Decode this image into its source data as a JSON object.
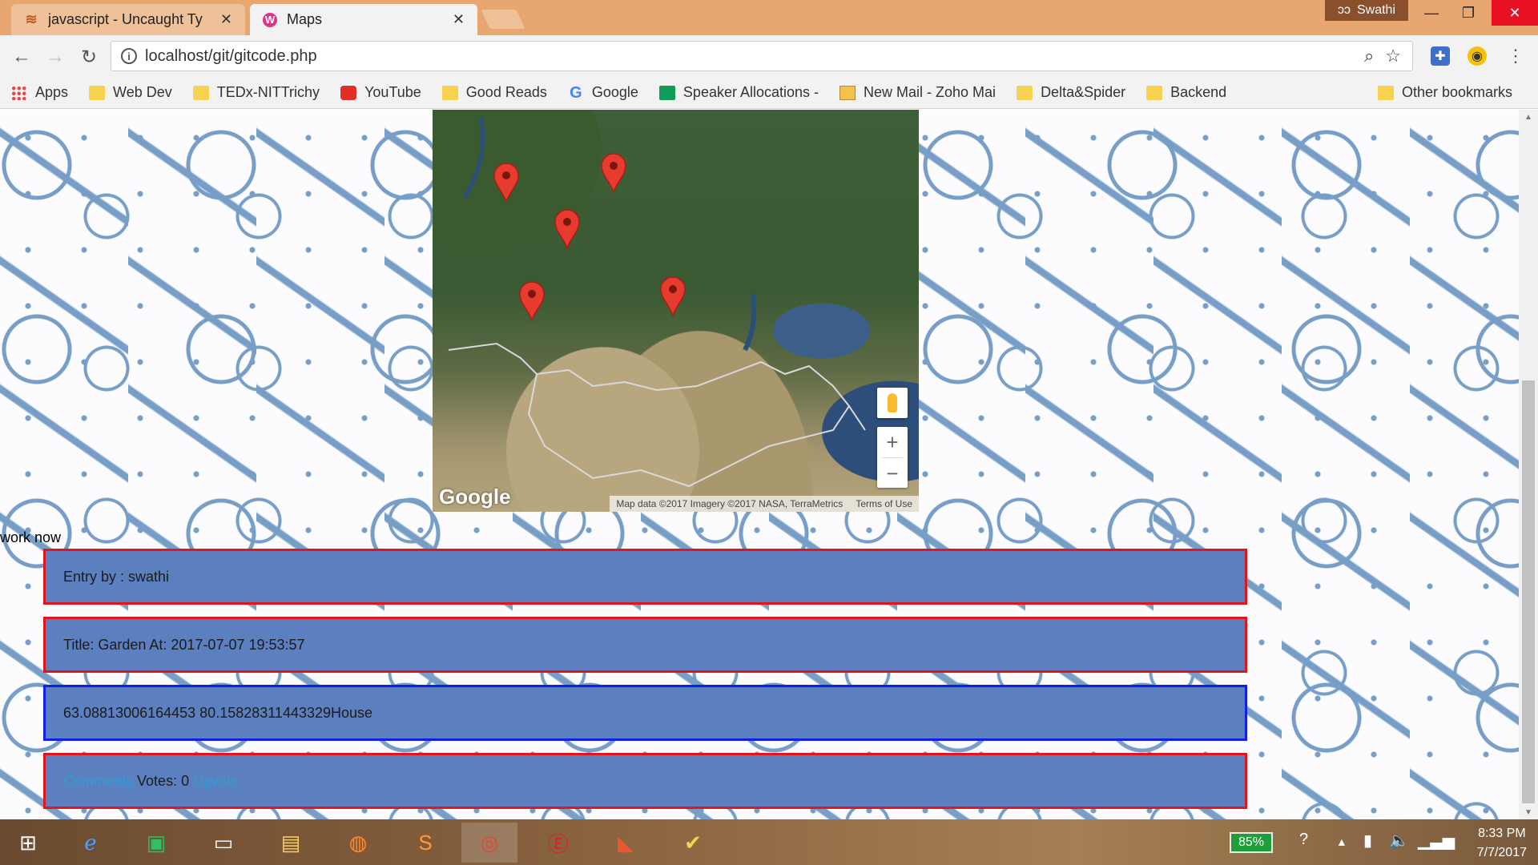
{
  "browser": {
    "tabs": [
      {
        "title": "javascript - Uncaught Ty",
        "close": "✕",
        "active": false
      },
      {
        "title": "Maps",
        "close": "✕",
        "active": true
      }
    ],
    "profile_name": "Swathi",
    "window_controls": {
      "minimize": "—",
      "maximize": "❐",
      "close": "✕"
    },
    "url": "localhost/git/gitcode.php"
  },
  "bookmarks": {
    "items": [
      {
        "label": "Apps",
        "icon": "apps-grid-icon"
      },
      {
        "label": "Web Dev",
        "icon": "folder-icon"
      },
      {
        "label": "TEDx-NITTrichy",
        "icon": "folder-icon"
      },
      {
        "label": "YouTube",
        "icon": "youtube-icon"
      },
      {
        "label": "Good Reads",
        "icon": "folder-icon"
      },
      {
        "label": "Google",
        "icon": "google-icon"
      },
      {
        "label": "Speaker Allocations -",
        "icon": "sheets-icon"
      },
      {
        "label": "New Mail - Zoho Mai",
        "icon": "mail-icon"
      },
      {
        "label": "Delta&Spider",
        "icon": "folder-icon"
      },
      {
        "label": "Backend",
        "icon": "folder-icon"
      }
    ],
    "other": "Other bookmarks"
  },
  "map": {
    "logo": "Google",
    "attribution": "Map data ©2017 Imagery ©2017 NASA, TerraMetrics",
    "terms": "Terms of Use",
    "zoom_in": "+",
    "zoom_out": "−",
    "marker_count": 5
  },
  "content": {
    "status_text": "work now",
    "entry_by": "Entry by : swathi",
    "title_line": "Title: Garden At: 2017-07-07 19:53:57",
    "coords_line": "63.08813006164453 80.15828311443329House",
    "comments_link": "Comments",
    "votes_text": " Votes: 0 ",
    "upvote_link": "Upvote"
  },
  "taskbar": {
    "battery": "85%",
    "time": "8:33 PM",
    "date": "7/7/2017"
  },
  "colors": {
    "entry_background": "#5b7fbf",
    "entry_border_red": "#e0161d",
    "entry_border_blue": "#1020e8",
    "link": "#2a9fd6",
    "marker": "#e63b2e"
  }
}
